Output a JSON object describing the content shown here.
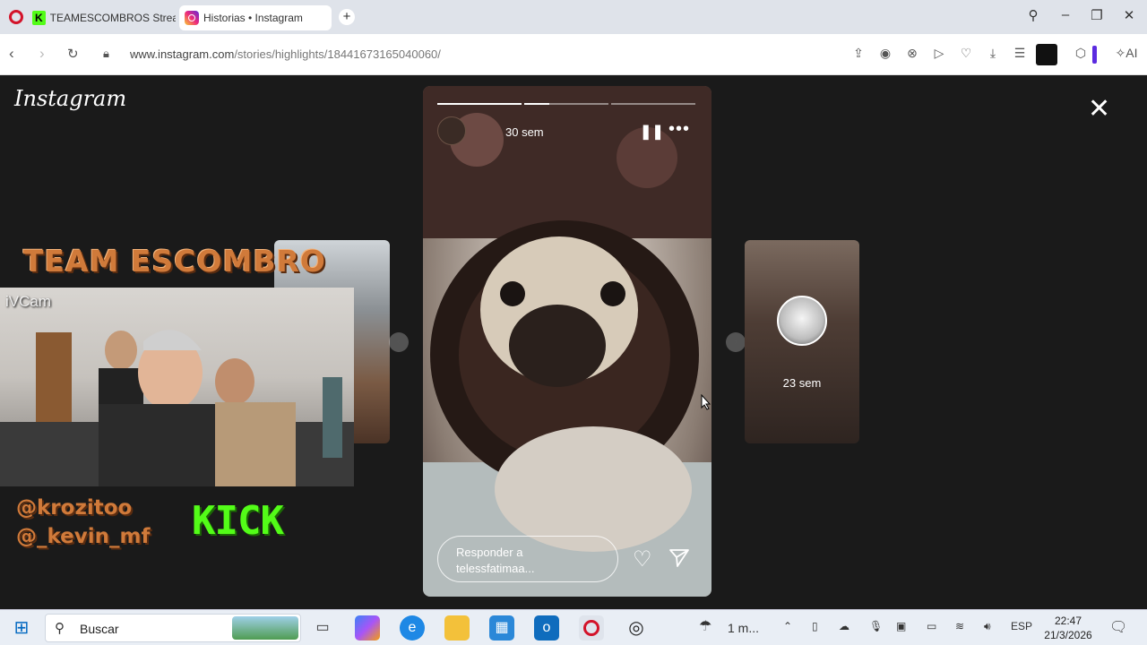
{
  "browser": {
    "tabs": [
      {
        "title": "TEAMESCOMBROS Stream",
        "favicon": "kick-icon"
      },
      {
        "title": "Historias • Instagram",
        "favicon": "instagram-icon",
        "active": true
      }
    ],
    "url_host": "www.instagram.com",
    "url_path": "/stories/highlights/18441673165040060/",
    "ai_label": "AI"
  },
  "page": {
    "logo": "Instagram",
    "story": {
      "time": "30 sem",
      "progress_segments": [
        1.0,
        0.3,
        0.0
      ],
      "reply_placeholder": "Responder a telessfatimaa..."
    },
    "next_preview": {
      "time": "23 sem"
    }
  },
  "overlay": {
    "title": "TEAM ESCOMBRO",
    "cam_label": "iVCam",
    "handle1": "@krozitoo",
    "handle2": "@_kevin_mf",
    "platform": "KICK"
  },
  "taskbar": {
    "search_placeholder": "Buscar",
    "weather": "1 m...",
    "language": "ESP",
    "time": "22:47",
    "date": "21/3/2026"
  },
  "colors": {
    "kick_green": "#53fc18",
    "opera_red": "#d3132a",
    "overlay_orange": "#d07a3a"
  }
}
